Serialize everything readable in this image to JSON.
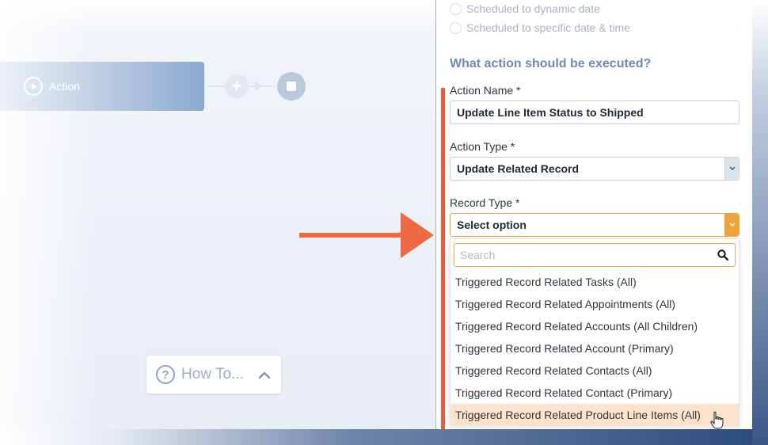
{
  "canvas": {
    "action_node_label": "Action",
    "add_icon": "plus-icon",
    "end_icon": "stop-icon",
    "howto_label": "How To..."
  },
  "panel": {
    "radio_options": [
      "Scheduled to dynamic date",
      "Scheduled to specific date & time"
    ],
    "section_title": "What action should be executed?",
    "action_name": {
      "label": "Action Name *",
      "value": "Update Line Item Status to Shipped"
    },
    "action_type": {
      "label": "Action Type *",
      "value": "Update Related Record"
    },
    "record_type": {
      "label": "Record Type *",
      "value": "Select option",
      "search_placeholder": "Search",
      "options": [
        "Triggered Record Related Tasks (All)",
        "Triggered Record Related Appointments (All)",
        "Triggered Record Related Accounts (All Children)",
        "Triggered Record Related Account (Primary)",
        "Triggered Record Related Contacts (All)",
        "Triggered Record Related Contact (Primary)",
        "Triggered Record Related Product Line Items (All)"
      ],
      "highlighted_index": 6
    }
  },
  "colors": {
    "accent_orange": "#f0a43a",
    "annotation_red": "#e85c3c",
    "section_blue": "#6e8bb3",
    "highlight": "#fde3cc"
  }
}
